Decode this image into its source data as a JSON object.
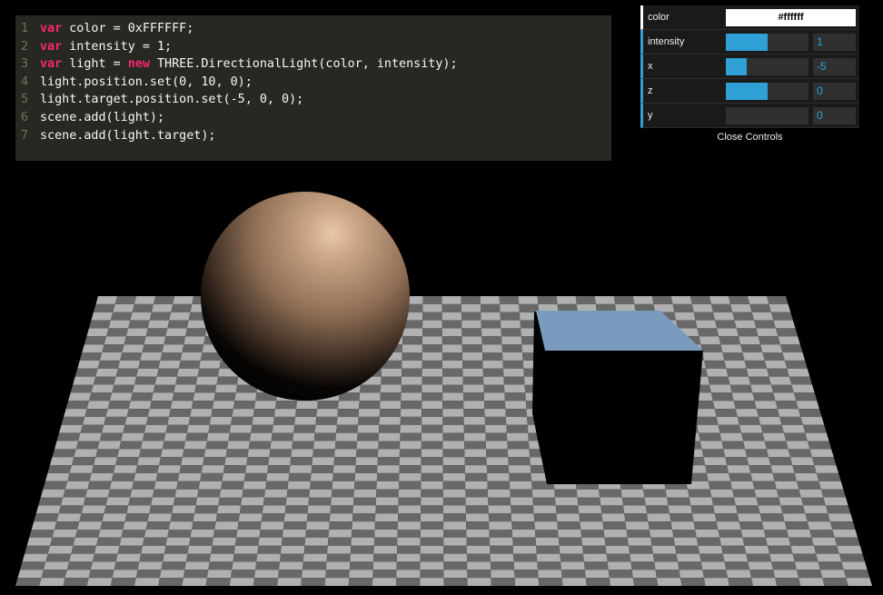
{
  "code": {
    "lines": [
      {
        "num": "1",
        "kw": "var",
        "rest": " color = 0xFFFFFF;"
      },
      {
        "num": "2",
        "kw": "var",
        "rest": " intensity = 1;"
      },
      {
        "num": "3",
        "kw": "var",
        "pre": " light = ",
        "kw2": "new",
        "rest": " THREE.DirectionalLight(color, intensity);"
      },
      {
        "num": "4",
        "kw": "",
        "rest": "light.position.set(0, 10, 0);"
      },
      {
        "num": "5",
        "kw": "",
        "rest": "light.target.position.set(-5, 0, 0);"
      },
      {
        "num": "6",
        "kw": "",
        "rest": "scene.add(light);"
      },
      {
        "num": "7",
        "kw": "",
        "rest": "scene.add(light.target);"
      }
    ]
  },
  "gui": {
    "color": {
      "label": "color",
      "value": "#ffffff"
    },
    "controllers": [
      {
        "label": "intensity",
        "value": "1",
        "fill": 0.5
      },
      {
        "label": "x",
        "value": "-5",
        "fill": 0.25
      },
      {
        "label": "z",
        "value": "0",
        "fill": 0.5
      },
      {
        "label": "y",
        "value": "0",
        "fill": 0.0
      }
    ],
    "close_label": "Close Controls"
  },
  "scene": {
    "floor_light": "#b0b0b0",
    "floor_dark": "#686868",
    "sphere_color": "#d9b697",
    "cube_top_color": "#7a9bbd",
    "cube_side_color": "#000000",
    "background": "#000000"
  }
}
